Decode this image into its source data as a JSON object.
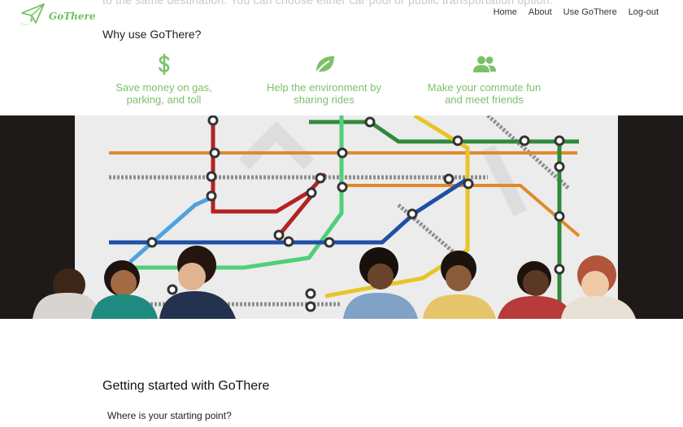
{
  "intro_text": "to the same destination. You can choose either car pool or public transportation option.",
  "logo": {
    "name": "GoThere",
    "icon": "paper-plane-icon",
    "color": "#6fbf5a"
  },
  "nav": {
    "home": "Home",
    "about": "About",
    "use": "Use GoThere",
    "logout": "Log-out"
  },
  "why": {
    "title": "Why use GoThere?",
    "accent_color": "#7cc16a",
    "features": [
      {
        "icon": "dollar-icon",
        "line1": "Save money on gas,",
        "line2": "parking, and toll"
      },
      {
        "icon": "leaf-icon",
        "line1": "Help the environment by",
        "line2": "sharing rides"
      },
      {
        "icon": "users-icon",
        "line1": "Make your commute fun",
        "line2": "and meet friends"
      }
    ]
  },
  "hero": {
    "subject": "people-in-front-of-subway-map-photo"
  },
  "getting_started": {
    "title": "Getting started with GoThere",
    "question": "Where is your starting point?"
  }
}
